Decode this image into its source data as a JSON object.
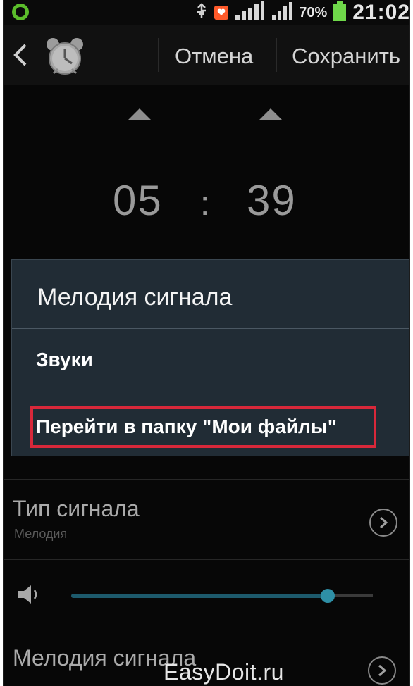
{
  "statusbar": {
    "battery_percent": "70%",
    "time": "21:02",
    "icons": [
      "android-icon",
      "usb-icon",
      "notification-icon",
      "wifi-signal-icon",
      "cell-signal-icon",
      "battery-icon"
    ]
  },
  "actionbar": {
    "icons": [
      "back-arrow-icon",
      "alarm-clock-icon"
    ],
    "cancel_label": "Отмена",
    "save_label": "Сохранить"
  },
  "time_picker": {
    "hours": "05",
    "separator": ":",
    "minutes": "39"
  },
  "dialog": {
    "title": "Мелодия сигнала",
    "items": [
      {
        "label": "Звуки"
      },
      {
        "label": "Перейти в папку \"Мои файлы\""
      }
    ],
    "highlight_color": "#d8283a"
  },
  "settings": {
    "signal_type": {
      "title": "Тип сигнала",
      "value": "Мелодия"
    },
    "volume": {
      "level": 0.85,
      "accent_color": "#2e8fa6"
    },
    "ringtone": {
      "title": "Мелодия сигнала"
    }
  },
  "watermark": "EasyDoit.ru"
}
